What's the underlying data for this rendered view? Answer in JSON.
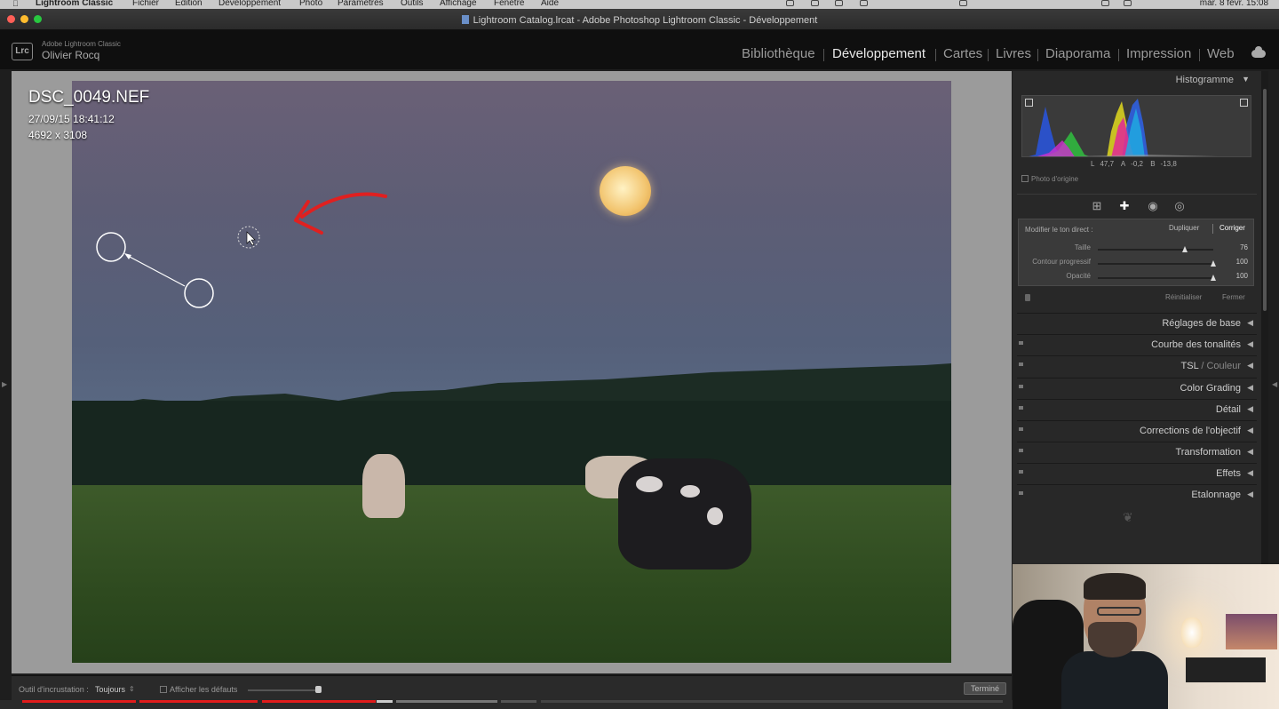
{
  "menubar": {
    "app_name": "Lightroom Classic",
    "items": [
      "Fichier",
      "Édition",
      "Développement",
      "Photo",
      "Paramètres",
      "Outils",
      "Affichage",
      "Fenêtre",
      "Aide"
    ],
    "datetime": "mar. 8 févr. 15:08"
  },
  "window": {
    "title": "Lightroom Catalog.lrcat - Adobe Photoshop Lightroom Classic - Développement"
  },
  "identity": {
    "logo": "Lrc",
    "brand": "Adobe Lightroom Classic",
    "user": "Olivier Rocq"
  },
  "modules": {
    "items": [
      "Bibliothèque",
      "Développement",
      "Cartes",
      "Livres",
      "Diaporama",
      "Impression",
      "Web"
    ],
    "active": "Développement"
  },
  "image_info": {
    "filename": "DSC_0049.NEF",
    "datetime": "27/09/15 18:41:12",
    "dimensions": "4692 x 3108"
  },
  "histogram": {
    "title": "Histogramme",
    "readout": {
      "L_label": "L",
      "L": "47,7",
      "A_label": "A",
      "A": "-0,2",
      "B_label": "B",
      "B": "-13,8"
    },
    "original_photo_label": "Photo d'origine"
  },
  "tools": [
    "crop-icon",
    "healing-icon",
    "red-eye-icon",
    "masking-icon"
  ],
  "healing": {
    "label": "Modifier le ton direct :",
    "duplicate_label": "Dupliquer",
    "correct_label": "Corriger",
    "sliders": [
      {
        "label": "Taille",
        "value": "76",
        "fraction": 0.75
      },
      {
        "label": "Contour progressif",
        "value": "100",
        "fraction": 1.0
      },
      {
        "label": "Opacité",
        "value": "100",
        "fraction": 1.0
      }
    ],
    "reset_label": "Réinitialiser",
    "close_label": "Fermer"
  },
  "sections": [
    {
      "label": "Réglages de base",
      "dim": ""
    },
    {
      "label": "Courbe des tonalités",
      "dim": ""
    },
    {
      "label": "TSL",
      "dim": " / Couleur"
    },
    {
      "label": "Color Grading",
      "dim": ""
    },
    {
      "label": "Détail",
      "dim": ""
    },
    {
      "label": "Corrections de l'objectif",
      "dim": ""
    },
    {
      "label": "Transformation",
      "dim": ""
    },
    {
      "label": "Effets",
      "dim": ""
    },
    {
      "label": "Etalonnage",
      "dim": ""
    }
  ],
  "toolbar": {
    "overlay_label": "Outil d'incrustation :",
    "overlay_value": "Toujours",
    "show_defaults_label": "Afficher les défauts",
    "done_label": "Terminé"
  },
  "colors": {
    "annotation_arrow": "#e02020",
    "panel_bg": "#282828",
    "workspace_bg": "#9b9b9b",
    "progress_red": "#e01b1b"
  }
}
